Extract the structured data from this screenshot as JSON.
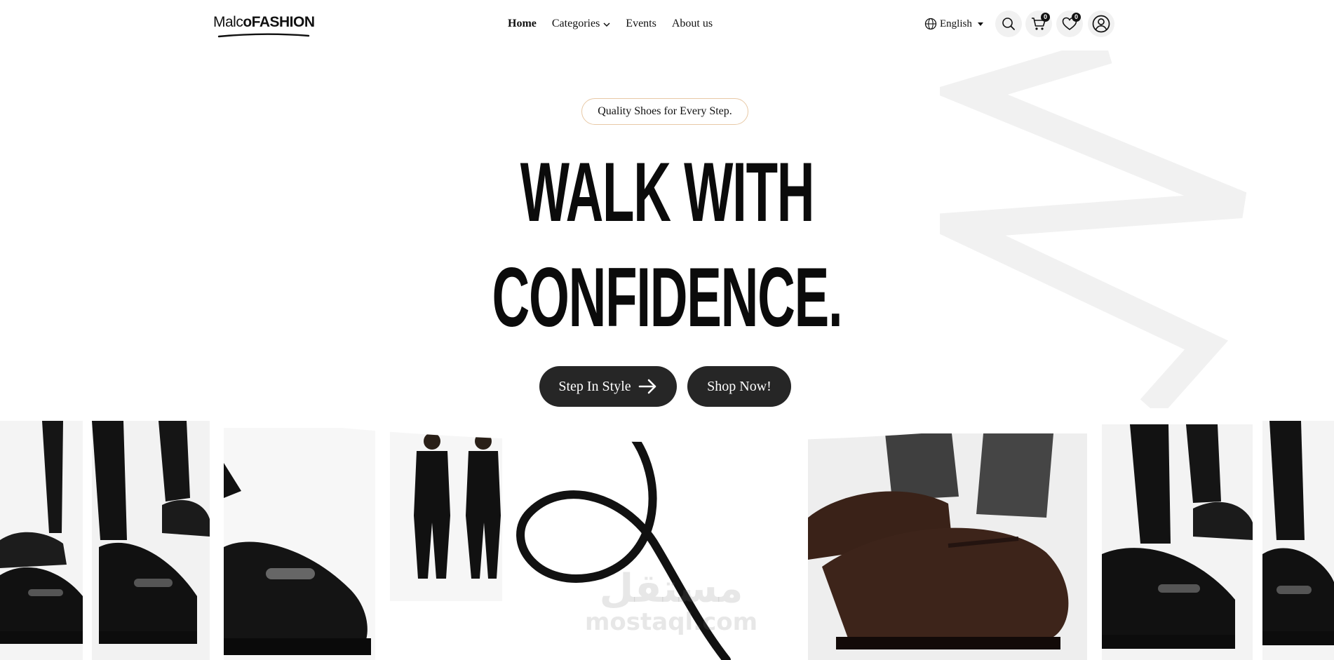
{
  "brand": {
    "logo_light": "Malc",
    "logo_o": "o",
    "logo_bold": "FASHION"
  },
  "nav": {
    "items": [
      {
        "label": "Home"
      },
      {
        "label": "Categories"
      },
      {
        "label": "Events"
      },
      {
        "label": "About us"
      }
    ]
  },
  "header_actions": {
    "language": "English",
    "cart_count": "0",
    "wishlist_count": "0",
    "icons": [
      "globe-icon",
      "search-icon",
      "cart-icon",
      "heart-icon",
      "user-icon"
    ]
  },
  "hero": {
    "tagline": "Quality Shoes for Every Step.",
    "headline_line1": "WALK WITH",
    "headline_line2": "CONFIDENCE.",
    "cta_primary": "Step In Style",
    "cta_secondary": "Shop Now!"
  },
  "watermark": {
    "arabic": "مستقل",
    "latin": "mostaql.com"
  },
  "colors": {
    "button": "#262626",
    "tagline_border": "#e8c9a6",
    "decor": "#f1f1f1"
  }
}
